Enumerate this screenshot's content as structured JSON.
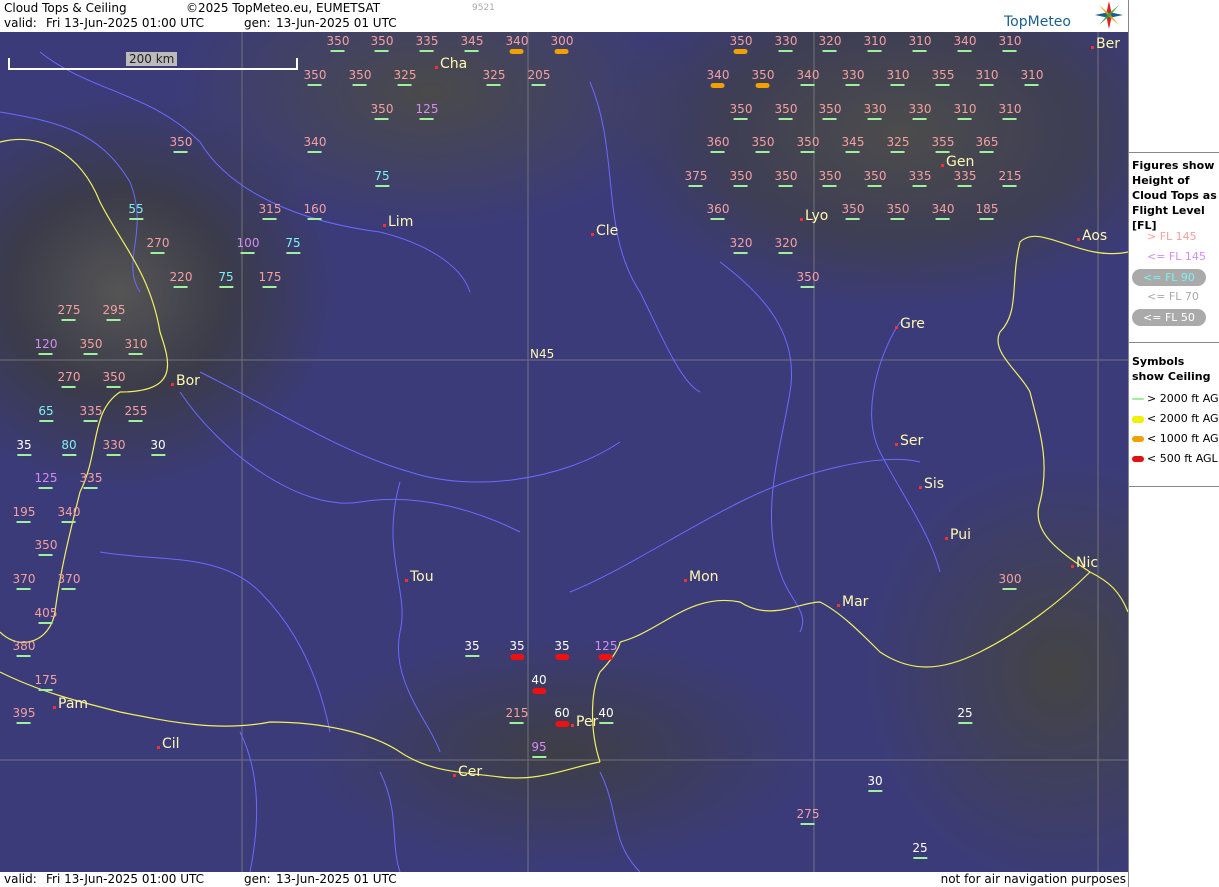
{
  "header": {
    "title": "Cloud Tops & Ceiling",
    "copyright": "©2025 TopMeteo.eu, EUMETSAT",
    "code": "9521",
    "valid_label": "valid:",
    "valid_value": "Fri  13-Jun-2025  01:00 UTC",
    "gen_label": "gen:",
    "gen_value": "13-Jun-2025 01 UTC",
    "brand": "TopMeteo"
  },
  "scale": {
    "label": "200 km"
  },
  "lat_label": "N45",
  "cities": [
    {
      "name": "Cha"
    },
    {
      "name": "Ber"
    },
    {
      "name": "Gen"
    },
    {
      "name": "Lim"
    },
    {
      "name": "Cle"
    },
    {
      "name": "Lyo"
    },
    {
      "name": "Aos"
    },
    {
      "name": "Gre"
    },
    {
      "name": "Bor"
    },
    {
      "name": "Ser"
    },
    {
      "name": "Sis"
    },
    {
      "name": "Pui"
    },
    {
      "name": "Nic"
    },
    {
      "name": "Tou"
    },
    {
      "name": "Mon"
    },
    {
      "name": "Mar"
    },
    {
      "name": "Pam"
    },
    {
      "name": "Cil"
    },
    {
      "name": "Per"
    },
    {
      "name": "Cer"
    }
  ],
  "flight_levels": [
    {
      "v": "350",
      "cat": "high",
      "ceil": "ok"
    },
    {
      "v": "350",
      "cat": "high",
      "ceil": "ok"
    },
    {
      "v": "335",
      "cat": "high",
      "ceil": "ok"
    },
    {
      "v": "345",
      "cat": "high",
      "ceil": "ok"
    },
    {
      "v": "340",
      "cat": "high",
      "ceil": "c1000"
    },
    {
      "v": "300",
      "cat": "high",
      "ceil": "c1000"
    },
    {
      "v": "350",
      "cat": "high",
      "ceil": "c1000"
    },
    {
      "v": "330",
      "cat": "high",
      "ceil": "ok"
    },
    {
      "v": "320",
      "cat": "high",
      "ceil": "ok"
    },
    {
      "v": "310",
      "cat": "high",
      "ceil": "ok"
    },
    {
      "v": "310",
      "cat": "high",
      "ceil": "ok"
    },
    {
      "v": "340",
      "cat": "high",
      "ceil": "ok"
    },
    {
      "v": "310",
      "cat": "high",
      "ceil": "ok"
    },
    {
      "v": "350",
      "cat": "high",
      "ceil": "ok"
    },
    {
      "v": "350",
      "cat": "high",
      "ceil": "ok"
    },
    {
      "v": "325",
      "cat": "high",
      "ceil": "ok"
    },
    {
      "v": "325",
      "cat": "high",
      "ceil": "ok"
    },
    {
      "v": "205",
      "cat": "high",
      "ceil": "ok"
    },
    {
      "v": "340",
      "cat": "high",
      "ceil": "c1000"
    },
    {
      "v": "350",
      "cat": "high",
      "ceil": "c1000"
    },
    {
      "v": "340",
      "cat": "high",
      "ceil": "ok"
    },
    {
      "v": "330",
      "cat": "high",
      "ceil": "ok"
    },
    {
      "v": "310",
      "cat": "high",
      "ceil": "ok"
    },
    {
      "v": "355",
      "cat": "high",
      "ceil": "ok"
    },
    {
      "v": "310",
      "cat": "high",
      "ceil": "ok"
    },
    {
      "v": "310",
      "cat": "high",
      "ceil": "ok"
    },
    {
      "v": "350",
      "cat": "high",
      "ceil": "ok"
    },
    {
      "v": "125",
      "cat": "mid",
      "ceil": "ok"
    },
    {
      "v": "350",
      "cat": "high",
      "ceil": "ok"
    },
    {
      "v": "350",
      "cat": "high",
      "ceil": "ok"
    },
    {
      "v": "350",
      "cat": "high",
      "ceil": "ok"
    },
    {
      "v": "330",
      "cat": "high",
      "ceil": "ok"
    },
    {
      "v": "330",
      "cat": "high",
      "ceil": "ok"
    },
    {
      "v": "310",
      "cat": "high",
      "ceil": "ok"
    },
    {
      "v": "310",
      "cat": "high",
      "ceil": "ok"
    },
    {
      "v": "350",
      "cat": "high",
      "ceil": "ok"
    },
    {
      "v": "340",
      "cat": "high",
      "ceil": "ok"
    },
    {
      "v": "360",
      "cat": "high",
      "ceil": "ok"
    },
    {
      "v": "350",
      "cat": "high",
      "ceil": "ok"
    },
    {
      "v": "350",
      "cat": "high",
      "ceil": "ok"
    },
    {
      "v": "345",
      "cat": "high",
      "ceil": "ok"
    },
    {
      "v": "325",
      "cat": "high",
      "ceil": "ok"
    },
    {
      "v": "355",
      "cat": "high",
      "ceil": "ok"
    },
    {
      "v": "365",
      "cat": "high",
      "ceil": "ok"
    },
    {
      "v": "75",
      "cat": "low",
      "ceil": "ok"
    },
    {
      "v": "375",
      "cat": "high",
      "ceil": "ok"
    },
    {
      "v": "350",
      "cat": "high",
      "ceil": "ok"
    },
    {
      "v": "350",
      "cat": "high",
      "ceil": "ok"
    },
    {
      "v": "350",
      "cat": "high",
      "ceil": "ok"
    },
    {
      "v": "350",
      "cat": "high",
      "ceil": "ok"
    },
    {
      "v": "335",
      "cat": "high",
      "ceil": "ok"
    },
    {
      "v": "335",
      "cat": "high",
      "ceil": "ok"
    },
    {
      "v": "215",
      "cat": "high",
      "ceil": "ok"
    },
    {
      "v": "55",
      "cat": "low",
      "ceil": "ok"
    },
    {
      "v": "315",
      "cat": "high",
      "ceil": "ok"
    },
    {
      "v": "160",
      "cat": "high",
      "ceil": "ok"
    },
    {
      "v": "360",
      "cat": "high",
      "ceil": "ok"
    },
    {
      "v": "350",
      "cat": "high",
      "ceil": "ok"
    },
    {
      "v": "350",
      "cat": "high",
      "ceil": "ok"
    },
    {
      "v": "340",
      "cat": "high",
      "ceil": "ok"
    },
    {
      "v": "185",
      "cat": "high",
      "ceil": "ok"
    },
    {
      "v": "270",
      "cat": "high",
      "ceil": "ok"
    },
    {
      "v": "100",
      "cat": "mid",
      "ceil": "ok"
    },
    {
      "v": "75",
      "cat": "low",
      "ceil": "ok"
    },
    {
      "v": "320",
      "cat": "high",
      "ceil": "ok"
    },
    {
      "v": "320",
      "cat": "high",
      "ceil": "ok"
    },
    {
      "v": "220",
      "cat": "high",
      "ceil": "ok"
    },
    {
      "v": "75",
      "cat": "low",
      "ceil": "ok"
    },
    {
      "v": "175",
      "cat": "high",
      "ceil": "ok"
    },
    {
      "v": "350",
      "cat": "high",
      "ceil": "ok"
    },
    {
      "v": "275",
      "cat": "high",
      "ceil": "ok"
    },
    {
      "v": "295",
      "cat": "high",
      "ceil": "ok"
    },
    {
      "v": "120",
      "cat": "mid",
      "ceil": "ok"
    },
    {
      "v": "350",
      "cat": "high",
      "ceil": "ok"
    },
    {
      "v": "310",
      "cat": "high",
      "ceil": "ok"
    },
    {
      "v": "270",
      "cat": "high",
      "ceil": "ok"
    },
    {
      "v": "350",
      "cat": "high",
      "ceil": "ok"
    },
    {
      "v": "65",
      "cat": "low",
      "ceil": "ok"
    },
    {
      "v": "335",
      "cat": "high",
      "ceil": "ok"
    },
    {
      "v": "255",
      "cat": "high",
      "ceil": "ok"
    },
    {
      "v": "35",
      "cat": "vlow",
      "ceil": "ok"
    },
    {
      "v": "80",
      "cat": "low",
      "ceil": "ok"
    },
    {
      "v": "330",
      "cat": "high",
      "ceil": "ok"
    },
    {
      "v": "30",
      "cat": "vlow",
      "ceil": "ok"
    },
    {
      "v": "125",
      "cat": "mid",
      "ceil": "ok"
    },
    {
      "v": "335",
      "cat": "high",
      "ceil": "ok"
    },
    {
      "v": "195",
      "cat": "high",
      "ceil": "ok"
    },
    {
      "v": "340",
      "cat": "high",
      "ceil": "ok"
    },
    {
      "v": "350",
      "cat": "high",
      "ceil": "ok"
    },
    {
      "v": "370",
      "cat": "high",
      "ceil": "ok"
    },
    {
      "v": "370",
      "cat": "high",
      "ceil": "ok"
    },
    {
      "v": "300",
      "cat": "high",
      "ceil": "ok"
    },
    {
      "v": "405",
      "cat": "high",
      "ceil": "ok"
    },
    {
      "v": "380",
      "cat": "high",
      "ceil": "ok"
    },
    {
      "v": "35",
      "cat": "vlow",
      "ceil": "ok"
    },
    {
      "v": "35",
      "cat": "vlow",
      "ceil": "c500"
    },
    {
      "v": "35",
      "cat": "vlow",
      "ceil": "c500"
    },
    {
      "v": "125",
      "cat": "mid",
      "ceil": "c500"
    },
    {
      "v": "175",
      "cat": "high",
      "ceil": "ok"
    },
    {
      "v": "40",
      "cat": "vlow",
      "ceil": "c500"
    },
    {
      "v": "395",
      "cat": "high",
      "ceil": "ok"
    },
    {
      "v": "215",
      "cat": "high",
      "ceil": "ok"
    },
    {
      "v": "60",
      "cat": "vlow",
      "ceil": "c500"
    },
    {
      "v": "40",
      "cat": "vlow",
      "ceil": "ok"
    },
    {
      "v": "25",
      "cat": "vlow",
      "ceil": "ok"
    },
    {
      "v": "95",
      "cat": "mid",
      "ceil": "ok"
    },
    {
      "v": "30",
      "cat": "vlow",
      "ceil": "ok"
    },
    {
      "v": "275",
      "cat": "high",
      "ceil": "ok"
    },
    {
      "v": "25",
      "cat": "vlow",
      "ceil": "ok"
    }
  ],
  "legend": {
    "fig_title": "Figures show Height of Cloud Tops as Flight Level  [FL]",
    "fl_items": [
      {
        "label": "> FL 145",
        "color": "#f4a0a0",
        "pill": false
      },
      {
        "label": "<= FL 145",
        "color": "#d48cf5",
        "pill": false
      },
      {
        "label": "<= FL 90",
        "color": "#7ff0f0",
        "pill": true
      },
      {
        "label": "<= FL 70",
        "color": "#aaaaaa",
        "pill": false
      },
      {
        "label": "<= FL 50",
        "color": "#ffffff",
        "pill": true
      }
    ],
    "sym_title": "Symbols show Ceiling",
    "sym_items": [
      {
        "label": "> 2000 ft AGL",
        "color": "#9ef09e"
      },
      {
        "label": "< 2000 ft AGL",
        "color": "#f0f000"
      },
      {
        "label": "< 1000 ft AGL",
        "color": "#f0a000"
      },
      {
        "label": "< 500 ft AGL",
        "color": "#e11111"
      }
    ]
  },
  "footer": {
    "valid_label": "valid:",
    "valid_value": "Fri  13-Jun-2025  01:00 UTC",
    "gen_label": "gen:",
    "gen_value": "13-Jun-2025 01 UTC",
    "disclaimer": "not for air navigation purposes"
  }
}
